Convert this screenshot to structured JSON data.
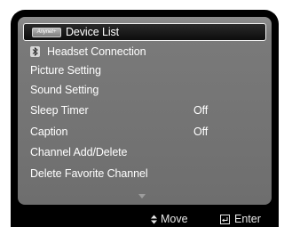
{
  "menu": {
    "items": [
      {
        "label": "Device List",
        "value": "",
        "icon": "anynet-logo-icon",
        "icon_text": "Anynet+",
        "selected": true
      },
      {
        "label": "Headset Connection",
        "value": "",
        "icon": "bluetooth-icon",
        "selected": false
      },
      {
        "label": "Picture Setting",
        "value": "",
        "selected": false
      },
      {
        "label": "Sound Setting",
        "value": "",
        "selected": false
      },
      {
        "label": "Sleep Timer",
        "value": "Off",
        "selected": false
      },
      {
        "label": "Caption",
        "value": "Off",
        "selected": false
      },
      {
        "label": "Channel Add/Delete",
        "value": "",
        "selected": false
      },
      {
        "label": "Delete Favorite Channel",
        "value": "",
        "selected": false
      }
    ],
    "more_below_icon": "scroll-down-arrow-icon"
  },
  "footer": {
    "move_icon": "up-down-arrow-icon",
    "move_label": "Move",
    "enter_icon": "enter-icon",
    "enter_label": "Enter"
  },
  "colors": {
    "panel": "#7a7a7a",
    "frame": "#000000",
    "text": "#ffffff",
    "selection_border": "#f0f0f0"
  }
}
